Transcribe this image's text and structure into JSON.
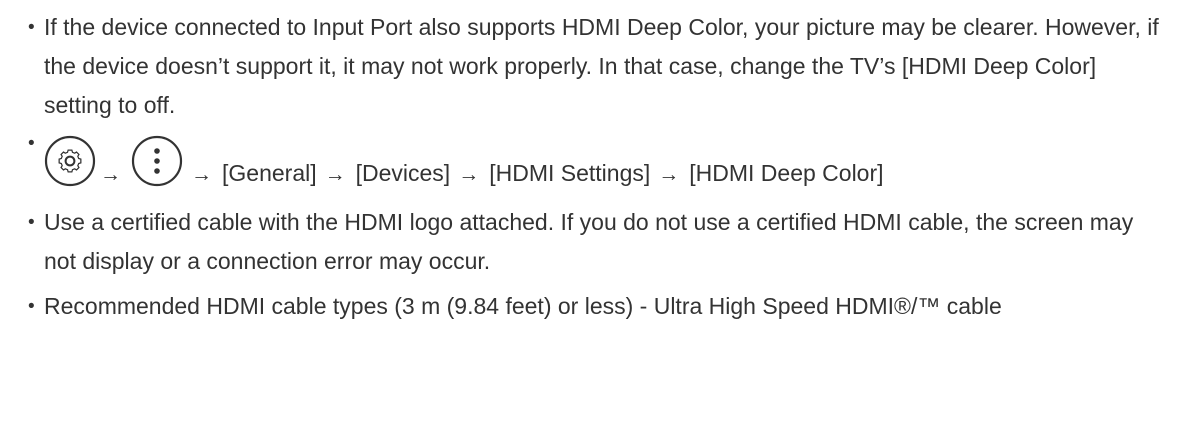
{
  "items": [
    {
      "text": "If the device connected to Input Port also supports HDMI Deep Color, your picture may be clearer. However, if the device doesn’t support it, it may not work properly. In that case, change the TV’s [HDMI Deep Color] setting to off."
    },
    {
      "icons": [
        "settings-gear-icon",
        "more-options-icon"
      ],
      "arrow": "→",
      "steps": [
        "[General]",
        "[Devices]",
        "[HDMI Settings]",
        "[HDMI Deep Color]"
      ]
    },
    {
      "text": "Use a certified cable with the HDMI logo attached. If you do not use a certified HDMI cable, the screen may not display or a connection error may occur."
    },
    {
      "text": "Recommended HDMI cable types (3 m (9.84 feet) or less) - Ultra High Speed HDMI®/™ cable"
    }
  ],
  "colors": {
    "text": "#333333",
    "icon_stroke": "#333333",
    "background": "#ffffff"
  }
}
